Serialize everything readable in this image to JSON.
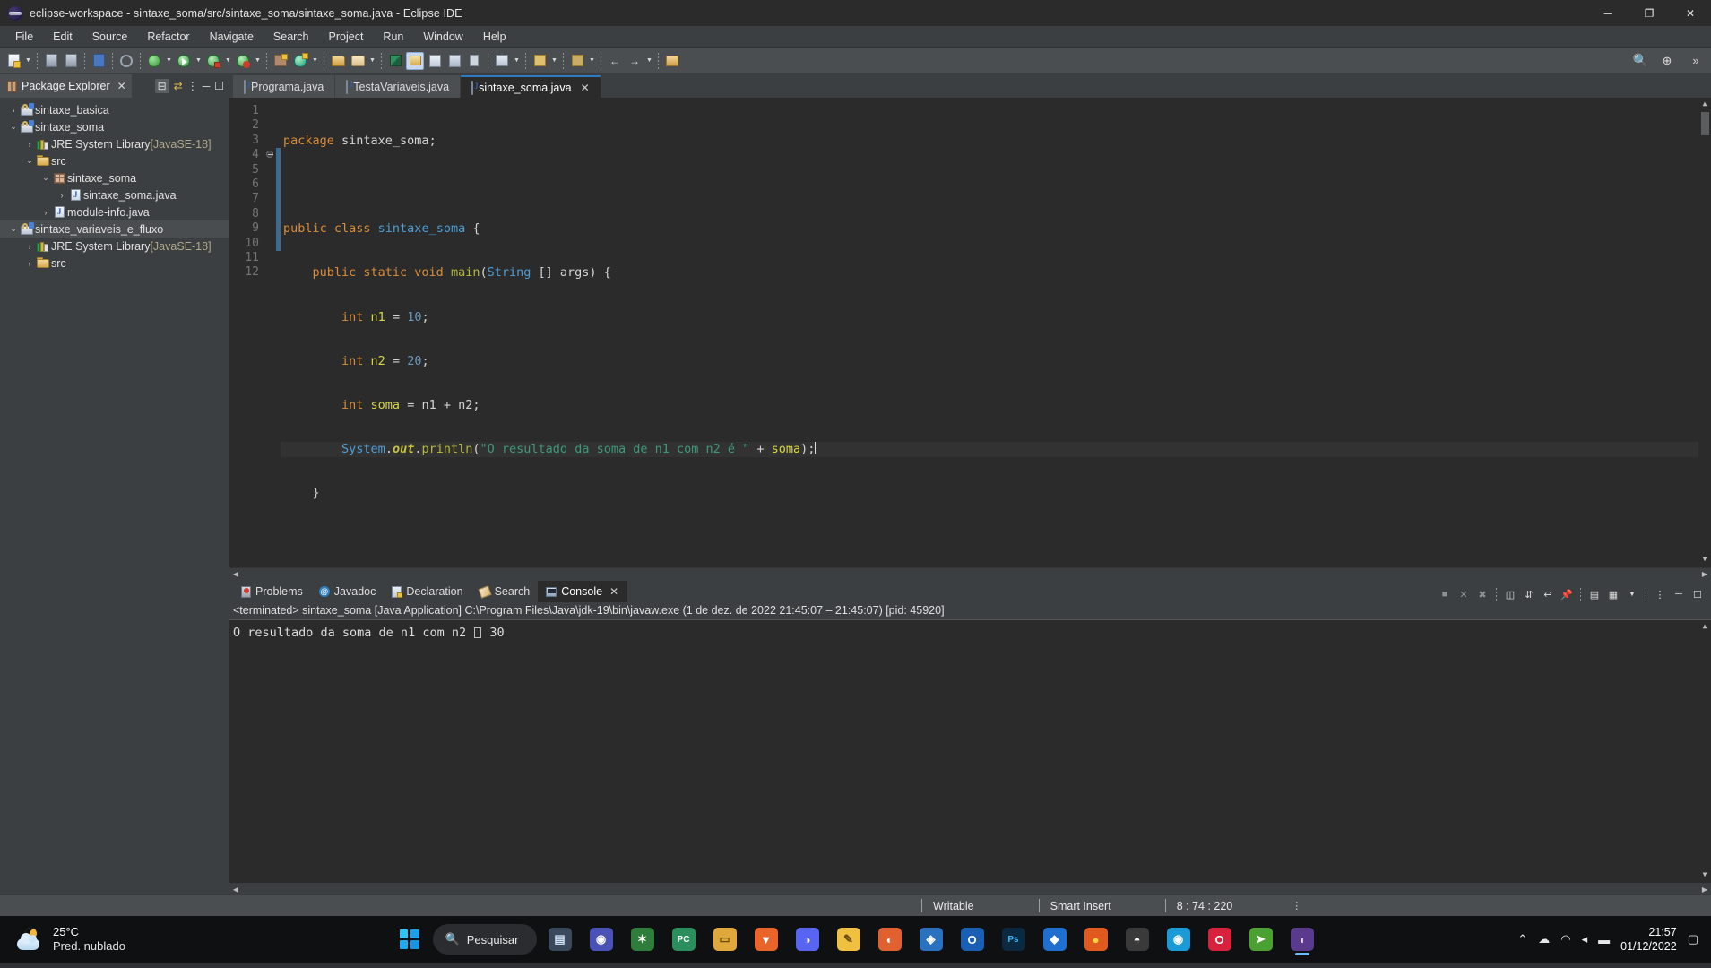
{
  "window": {
    "title": "eclipse-workspace - sintaxe_soma/src/sintaxe_soma/sintaxe_soma.java - Eclipse IDE",
    "icon": "eclipse-icon",
    "minimize": "─",
    "maximize": "❐",
    "close": "✕"
  },
  "menubar": {
    "items": [
      "File",
      "Edit",
      "Source",
      "Refactor",
      "Navigate",
      "Search",
      "Project",
      "Run",
      "Window",
      "Help"
    ]
  },
  "toolbar": {
    "search_icon": "search-icon",
    "overflow": "»",
    "perspective": "⊕"
  },
  "explorer": {
    "tab_label": "Package Explorer",
    "tab_icon": "package-explorer-icon",
    "close_icon": "✕",
    "tools": {
      "collapse_all": "collapse-all-icon",
      "link_with_editor": "link-with-editor-icon",
      "view_menu": "view-menu-icon",
      "minimize": "minimize-icon",
      "maximize": "maximize-icon"
    },
    "tree": [
      {
        "label": "sintaxe_basica",
        "icon": "java-project-icon",
        "twisty": "›",
        "indent": 0,
        "highlight": false
      },
      {
        "label": "sintaxe_soma",
        "icon": "java-project-icon",
        "twisty": "⌄",
        "indent": 0,
        "highlight": false
      },
      {
        "label": "JRE System Library",
        "suffix": " [JavaSE-18]",
        "icon": "jre-library-icon",
        "twisty": "›",
        "indent": 1,
        "highlight": false
      },
      {
        "label": "src",
        "icon": "source-folder-icon",
        "twisty": "⌄",
        "indent": 1,
        "highlight": false
      },
      {
        "label": "sintaxe_soma",
        "icon": "package-icon",
        "twisty": "⌄",
        "indent": 2,
        "highlight": false
      },
      {
        "label": "sintaxe_soma.java",
        "icon": "java-file-icon",
        "twisty": "›",
        "indent": 3,
        "highlight": false
      },
      {
        "label": "module-info.java",
        "icon": "java-file-icon",
        "twisty": "›",
        "indent": 2,
        "highlight": false
      },
      {
        "label": "sintaxe_variaveis_e_fluxo",
        "icon": "java-project-icon",
        "twisty": "⌄",
        "indent": 0,
        "highlight": true
      },
      {
        "label": "JRE System Library",
        "suffix": " [JavaSE-18]",
        "icon": "jre-library-icon",
        "twisty": "›",
        "indent": 1,
        "highlight": false
      },
      {
        "label": "src",
        "icon": "source-folder-icon",
        "twisty": "›",
        "indent": 1,
        "highlight": false
      }
    ]
  },
  "editor": {
    "tabs": [
      {
        "label": "Programa.java",
        "icon": "java-file-icon",
        "active": false,
        "closable": false
      },
      {
        "label": "TestaVariaveis.java",
        "icon": "java-file-icon",
        "active": false,
        "closable": false
      },
      {
        "label": "sintaxe_soma.java",
        "icon": "java-file-icon",
        "active": true,
        "closable": true,
        "close_icon": "✕"
      }
    ],
    "line_numbers": [
      "1",
      "2",
      "3",
      "4",
      "5",
      "6",
      "7",
      "8",
      "9",
      "10",
      "11",
      "12"
    ],
    "fold_marker_line": 4,
    "current_line": 8,
    "code_lines": [
      {
        "n": 1,
        "tokens": [
          {
            "t": "package ",
            "c": "kw"
          },
          {
            "t": "sintaxe_soma;",
            "c": "pln"
          }
        ]
      },
      {
        "n": 2,
        "tokens": []
      },
      {
        "n": 3,
        "tokens": [
          {
            "t": "public class ",
            "c": "kw"
          },
          {
            "t": "sintaxe_soma",
            "c": "cls"
          },
          {
            "t": " {",
            "c": "pln"
          }
        ]
      },
      {
        "n": 4,
        "tokens": [
          {
            "t": "    public static void ",
            "c": "kw"
          },
          {
            "t": "main",
            "c": "mth"
          },
          {
            "t": "(",
            "c": "pln"
          },
          {
            "t": "String",
            "c": "cls"
          },
          {
            "t": " [] args) {",
            "c": "pln"
          }
        ]
      },
      {
        "n": 5,
        "tokens": [
          {
            "t": "        int ",
            "c": "kw"
          },
          {
            "t": "n1",
            "c": "var"
          },
          {
            "t": " = ",
            "c": "pln"
          },
          {
            "t": "10",
            "c": "num"
          },
          {
            "t": ";",
            "c": "pln"
          }
        ]
      },
      {
        "n": 6,
        "tokens": [
          {
            "t": "        int ",
            "c": "kw"
          },
          {
            "t": "n2",
            "c": "var"
          },
          {
            "t": " = ",
            "c": "pln"
          },
          {
            "t": "20",
            "c": "num"
          },
          {
            "t": ";",
            "c": "pln"
          }
        ]
      },
      {
        "n": 7,
        "tokens": [
          {
            "t": "        int ",
            "c": "kw"
          },
          {
            "t": "soma",
            "c": "var"
          },
          {
            "t": " = n1 + n2;",
            "c": "pln"
          }
        ]
      },
      {
        "n": 8,
        "tokens": [
          {
            "t": "        ",
            "c": "pln"
          },
          {
            "t": "System",
            "c": "cls"
          },
          {
            "t": ".",
            "c": "pln"
          },
          {
            "t": "out",
            "c": "fld"
          },
          {
            "t": ".",
            "c": "pln"
          },
          {
            "t": "println",
            "c": "mth"
          },
          {
            "t": "(",
            "c": "pln"
          },
          {
            "t": "\"O resultado da soma de n1 com n2 é \"",
            "c": "str"
          },
          {
            "t": " + ",
            "c": "pln"
          },
          {
            "t": "soma",
            "c": "var"
          },
          {
            "t": ");",
            "c": "pln"
          }
        ]
      },
      {
        "n": 9,
        "tokens": [
          {
            "t": "    }",
            "c": "pln"
          }
        ]
      },
      {
        "n": 10,
        "tokens": []
      },
      {
        "n": 11,
        "tokens": [
          {
            "t": "}",
            "c": "pln"
          }
        ]
      },
      {
        "n": 12,
        "tokens": []
      }
    ]
  },
  "console": {
    "tabs": [
      {
        "label": "Problems",
        "icon": "problems-icon",
        "active": false
      },
      {
        "label": "Javadoc",
        "icon": "javadoc-icon",
        "active": false
      },
      {
        "label": "Declaration",
        "icon": "declaration-icon",
        "active": false
      },
      {
        "label": "Search",
        "icon": "search-tab-icon",
        "active": false
      },
      {
        "label": "Console",
        "icon": "console-icon",
        "active": true,
        "close_icon": "✕"
      }
    ],
    "tools": [
      "terminate-icon",
      "remove-launch-icon",
      "remove-all-terminated-icon",
      "clear-console-icon",
      "scroll-lock-icon",
      "word-wrap-icon",
      "pin-console-icon",
      "display-selected-console-icon",
      "open-console-icon",
      "view-menu-icon",
      "minimize-icon",
      "maximize-icon"
    ],
    "header": "<terminated> sintaxe_soma [Java Application] C:\\Program Files\\Java\\jdk-19\\bin\\javaw.exe  (1 de dez. de 2022 21:45:07 – 21:45:07) [pid: 45920]",
    "output_before": "O resultado da soma de n1 com n2 ",
    "output_box_glyph": "missing-glyph-box",
    "output_after": " 30"
  },
  "statusbar": {
    "writable": "Writable",
    "insert_mode": "Smart Insert",
    "cursor_position": "8 : 74 : 220",
    "overflow": "⋮"
  },
  "taskbar": {
    "weather": {
      "temperature": "25°C",
      "condition": "Pred. nublado",
      "icon": "moon-cloud-icon"
    },
    "start_icon": "windows-start-icon",
    "search": {
      "placeholder": "Pesquisar",
      "icon": "search-icon"
    },
    "apps": [
      {
        "name": "task-view",
        "glyph": "▤",
        "bg": "#3a4a5c",
        "color": "#cfe4f5",
        "active": false
      },
      {
        "name": "microsoft-teams",
        "glyph": "◉",
        "bg": "#4a52b8",
        "color": "#ffffff",
        "active": false
      },
      {
        "name": "xbox",
        "glyph": "✶",
        "bg": "#2f7d3a",
        "color": "#ffffff",
        "active": false
      },
      {
        "name": "pycharm",
        "glyph": "PC",
        "bg": "#2a8f5c",
        "color": "#ffffff",
        "active": false
      },
      {
        "name": "file-explorer",
        "glyph": "▭",
        "bg": "#e0a83c",
        "color": "#6b4c10",
        "active": false
      },
      {
        "name": "brave-browser",
        "glyph": "▼",
        "bg": "#e8642a",
        "color": "#ffffff",
        "active": false
      },
      {
        "name": "discord",
        "glyph": "◑",
        "bg": "#5865f2",
        "color": "#ffffff",
        "active": false
      },
      {
        "name": "notes-app",
        "glyph": "✎",
        "bg": "#f0c040",
        "color": "#6b4c10",
        "active": false
      },
      {
        "name": "firefox-dev",
        "glyph": "◐",
        "bg": "#e06030",
        "color": "#ffffff",
        "active": false
      },
      {
        "name": "vs-code",
        "glyph": "◈",
        "bg": "#2a72c0",
        "color": "#ffffff",
        "active": false
      },
      {
        "name": "outlook",
        "glyph": "O",
        "bg": "#1a5fb4",
        "color": "#ffffff",
        "active": false
      },
      {
        "name": "photoshop",
        "glyph": "Ps",
        "bg": "#0b2a42",
        "color": "#3fb0f0",
        "active": false
      },
      {
        "name": "dropbox",
        "glyph": "◆",
        "bg": "#1f6fd0",
        "color": "#ffffff",
        "active": false
      },
      {
        "name": "firefox",
        "glyph": "●",
        "bg": "#e05a20",
        "color": "#ffd23f",
        "active": false
      },
      {
        "name": "pandas-app",
        "glyph": "◓",
        "bg": "#3a3a3a",
        "color": "#ffffff",
        "active": false
      },
      {
        "name": "microsoft-edge",
        "glyph": "◉",
        "bg": "#1a9bd7",
        "color": "#ffffff",
        "active": false
      },
      {
        "name": "opera",
        "glyph": "O",
        "bg": "#d8213c",
        "color": "#ffffff",
        "active": false
      },
      {
        "name": "utorrent",
        "glyph": "➤",
        "bg": "#4aa030",
        "color": "#ffffff",
        "active": false
      },
      {
        "name": "eclipse-ide",
        "glyph": "◖",
        "bg": "#5a3a8c",
        "color": "#e8d8f5",
        "active": true
      }
    ],
    "tray": {
      "chevron": "⌃",
      "cloud": "☁",
      "wifi": "◠",
      "volume": "◂",
      "battery": "▬",
      "notification": "▢"
    },
    "clock": {
      "time": "21:57",
      "date": "01/12/2022"
    }
  }
}
